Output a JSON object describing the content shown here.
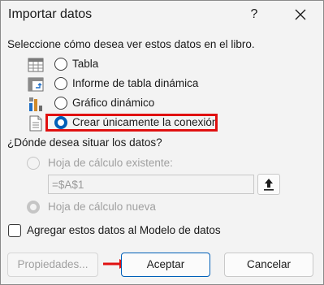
{
  "dialog": {
    "title": "Importar datos",
    "help_label": "?",
    "close_icon": "close-icon"
  },
  "view_section": {
    "prompt": "Seleccione cómo desea ver estos datos en el libro.",
    "options": [
      {
        "label": "Tabla",
        "icon": "table-icon",
        "selected": false
      },
      {
        "label": "Informe de tabla dinámica",
        "icon": "pivot-table-icon",
        "selected": false
      },
      {
        "label": "Gráfico dinámico",
        "icon": "pivot-chart-icon",
        "selected": false
      },
      {
        "label": "Crear únicamente la conexión",
        "icon": "connection-only-icon",
        "selected": true
      }
    ],
    "highlight_color": "#e01010"
  },
  "location_section": {
    "prompt": "¿Dónde desea situar los datos?",
    "existing_sheet_label": "Hoja de cálculo existente:",
    "address_value": "=$A$1",
    "new_sheet_label": "Hoja de cálculo nueva",
    "new_sheet_selected": true,
    "disabled": true
  },
  "data_model": {
    "label": "Agregar estos datos al Modelo de datos",
    "checked": false
  },
  "buttons": {
    "properties": "Propiedades...",
    "accept": "Aceptar",
    "cancel": "Cancelar"
  },
  "colors": {
    "accent": "#005fb8",
    "annotation_red": "#e01010"
  }
}
